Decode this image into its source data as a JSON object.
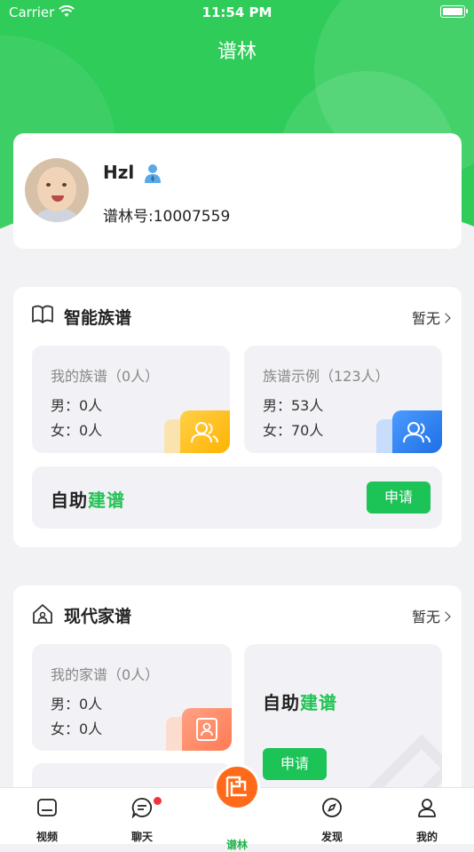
{
  "status_bar": {
    "carrier": "Carrier",
    "time": "11:54 PM"
  },
  "header": {
    "title": "谱林"
  },
  "profile": {
    "name": "Hzl",
    "id_text": "谱林号:10007559"
  },
  "smart_genealogy": {
    "title": "智能族谱",
    "more_label": "暂无",
    "my_tile": {
      "title": "我的族谱（0人）",
      "male": "男：0人",
      "female": "女：0人"
    },
    "example_tile": {
      "title": "族谱示例（123人）",
      "male": "男：53人",
      "female": "女：70人"
    },
    "self_build": {
      "brand_dark": "自助",
      "brand_green": "建谱",
      "apply_label": "申请"
    }
  },
  "modern_genealogy": {
    "title": "现代家谱",
    "more_label": "暂无",
    "my_tile": {
      "title": "我的家谱（0人）",
      "male": "男：0人",
      "female": "女：0人"
    },
    "self_build": {
      "brand_dark": "自助",
      "brand_green": "建谱",
      "apply_label": "申请"
    }
  },
  "tabbar": {
    "items": [
      {
        "label": "视频",
        "icon": "video-icon"
      },
      {
        "label": "聊天",
        "icon": "chat-icon"
      },
      {
        "label": "谱林",
        "icon": "pulin-logo-icon"
      },
      {
        "label": "发现",
        "icon": "compass-icon"
      },
      {
        "label": "我的",
        "icon": "user-icon"
      }
    ]
  },
  "colors": {
    "primary_green": "#2fcc5a",
    "button_green": "#1cc357",
    "orange": "#ff6a1a",
    "badge_yellow": "#ffc21a",
    "badge_blue": "#3a86f7",
    "badge_salmon": "#ff8a6a"
  }
}
